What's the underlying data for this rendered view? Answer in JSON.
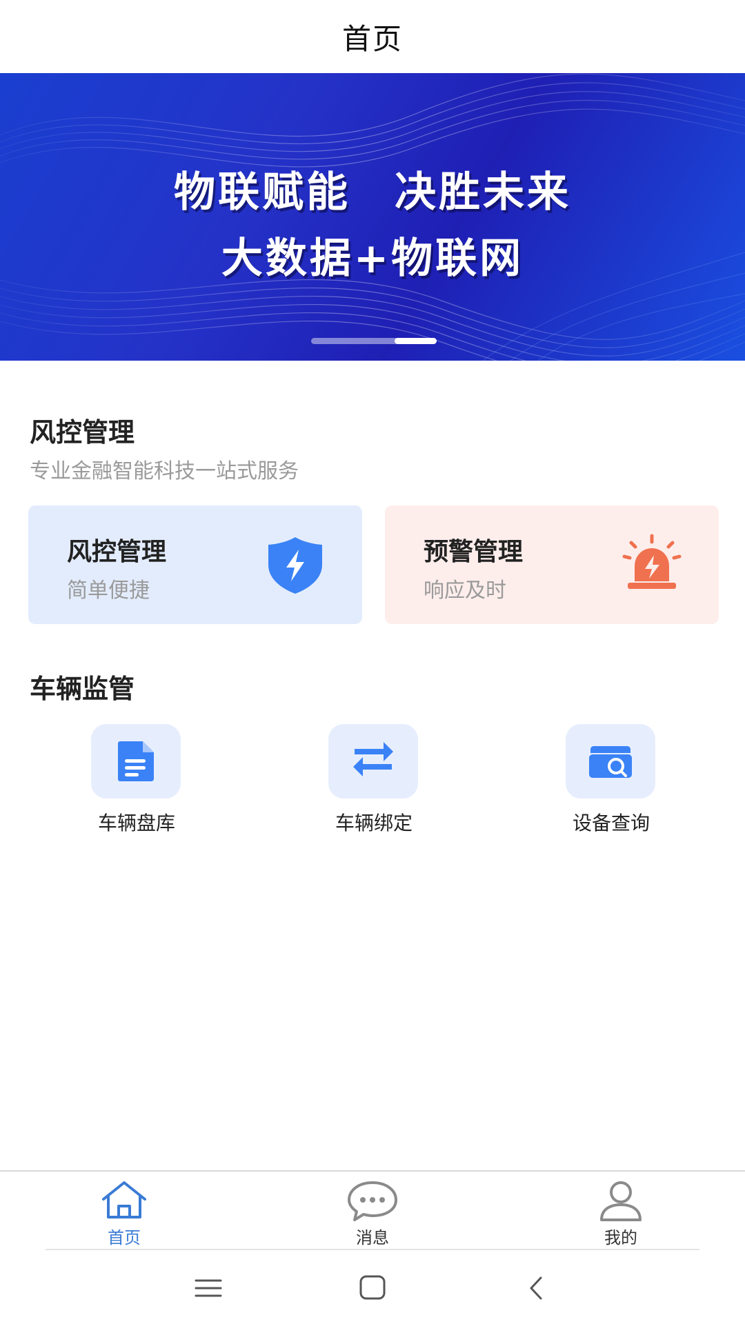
{
  "header": {
    "title": "首页"
  },
  "banner": {
    "line1": "物联赋能　决胜未来",
    "line2": "大数据+物联网",
    "slide_count": 2,
    "active_slide": 2
  },
  "risk_section": {
    "title": "风控管理",
    "subtitle": "专业金融智能科技一站式服务",
    "cards": [
      {
        "title": "风控管理",
        "subtitle": "简单便捷",
        "icon": "shield-lightning-icon",
        "color": "#e3ecfd"
      },
      {
        "title": "预警管理",
        "subtitle": "响应及时",
        "icon": "siren-alarm-icon",
        "color": "#fdeeec"
      }
    ]
  },
  "vehicle_section": {
    "title": "车辆监管",
    "items": [
      {
        "label": "车辆盘库",
        "icon": "document-list-icon"
      },
      {
        "label": "车辆绑定",
        "icon": "swap-arrows-icon"
      },
      {
        "label": "设备查询",
        "icon": "device-search-icon"
      }
    ]
  },
  "tabbar": {
    "tabs": [
      {
        "label": "首页",
        "icon": "home-icon",
        "active": true
      },
      {
        "label": "消息",
        "icon": "chat-bubble-icon",
        "active": false
      },
      {
        "label": "我的",
        "icon": "user-icon",
        "active": false
      }
    ]
  },
  "system_nav": {
    "buttons": [
      "menu-icon",
      "home-square-icon",
      "back-chevron-icon"
    ]
  },
  "colors": {
    "accent_blue": "#3a7bd5",
    "icon_blue": "#3a82f6",
    "alarm_orange": "#f0714f",
    "card_blue_bg": "#e3ecfd",
    "card_pink_bg": "#fdeeec",
    "muted_text": "#9a9a9a"
  }
}
